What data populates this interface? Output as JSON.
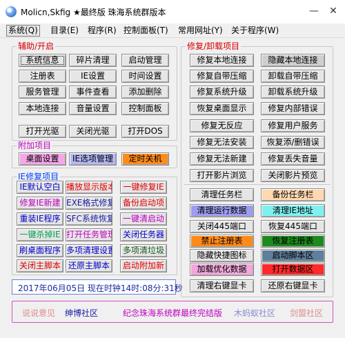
{
  "window": {
    "title": "Molicn,Skfig ★最终版 珠海系统群版本",
    "minimize_glyph": "—",
    "close_glyph": "✕"
  },
  "menu": [
    {
      "label": "系统(Q)",
      "active": true
    },
    {
      "label": "目录(E)"
    },
    {
      "label": "程序(R)"
    },
    {
      "label": "控制面板(T)"
    },
    {
      "label": "常用网址(Y)"
    },
    {
      "label": "关于程序(W)"
    }
  ],
  "groups": {
    "aux": {
      "title": "辅助/开启",
      "title_color": "#d40000"
    },
    "repair": {
      "title": "修复/卸载项目",
      "title_color": "#d40000"
    },
    "extra": {
      "title": "附加项目",
      "title_color": "#c000c0"
    },
    "ie": {
      "title": "IE修复项目",
      "title_color": "#0040ff"
    }
  },
  "buttons": {
    "aux": [
      {
        "label": "系统信息",
        "color": "#000000",
        "bg": "#e6e6e6",
        "focused": true
      },
      {
        "label": "碎片清理",
        "color": "#000000",
        "bg": "#e6e6e6"
      },
      {
        "label": "启动管理",
        "color": "#000000",
        "bg": "#e6e6e6"
      },
      {
        "label": "注册表",
        "color": "#000000",
        "bg": "#e6e6e6"
      },
      {
        "label": "IE设置",
        "color": "#000000",
        "bg": "#e6e6e6"
      },
      {
        "label": "时间设置",
        "color": "#000000",
        "bg": "#e6e6e6"
      },
      {
        "label": "服务管理",
        "color": "#000000",
        "bg": "#e6e6e6"
      },
      {
        "label": "事件查看",
        "color": "#000000",
        "bg": "#e6e6e6"
      },
      {
        "label": "添加删除",
        "color": "#000000",
        "bg": "#e6e6e6"
      },
      {
        "label": "本地连接",
        "color": "#000000",
        "bg": "#e6e6e6"
      },
      {
        "label": "音量设置",
        "color": "#000000",
        "bg": "#e6e6e6"
      },
      {
        "label": "控制面板",
        "color": "#000000",
        "bg": "#e6e6e6"
      },
      {
        "label": "打开光驱",
        "color": "#000000",
        "bg": "#e6e6e6"
      },
      {
        "label": "关闭光驱",
        "color": "#000000",
        "bg": "#e6e6e6"
      },
      {
        "label": "打开DOS",
        "color": "#000000",
        "bg": "#e6e6e6"
      }
    ],
    "extra": [
      {
        "label": "桌面设置",
        "color": "#000000",
        "bg": "#f4a6e8"
      },
      {
        "label": "IE选项管理",
        "color": "#000000",
        "bg": "#b4b8f4"
      },
      {
        "label": "定时关机",
        "color": "#000000",
        "bg": "#ff8c1a"
      }
    ],
    "ie": [
      {
        "label": "IE默认空白",
        "color": "#0000c8",
        "bg": "#e6e6e6"
      },
      {
        "label": "播放显示版本",
        "color": "#e00000",
        "bg": "#e6e6e6"
      },
      {
        "label": "一键修复IE",
        "color": "#e00000",
        "bg": "#e6e6e6"
      },
      {
        "label": "修复IE新建",
        "color": "#c000c0",
        "bg": "#e6e6e6"
      },
      {
        "label": "EXE格式修复",
        "color": "#1a1aa0",
        "bg": "#e6e6e6"
      },
      {
        "label": "备份启动项",
        "color": "#e00000",
        "bg": "#e6e6e6"
      },
      {
        "label": "重装IE程序",
        "color": "#0000c8",
        "bg": "#e6e6e6"
      },
      {
        "label": "SFC系统恢复",
        "color": "#1a1aa0",
        "bg": "#e6e6e6"
      },
      {
        "label": "一键清启动",
        "color": "#c000c0",
        "bg": "#e6e6e6"
      },
      {
        "label": "一键杀掉IE",
        "color": "#00a050",
        "bg": "#e6e6e6"
      },
      {
        "label": "打开任务管理",
        "color": "#c000c0",
        "bg": "#e6e6e6"
      },
      {
        "label": "关闭任务器",
        "color": "#0000c8",
        "bg": "#e6e6e6"
      },
      {
        "label": "刷桌面程序",
        "color": "#0000c8",
        "bg": "#e6e6e6"
      },
      {
        "label": "多项清理设置",
        "color": "#0000c8",
        "bg": "#e6e6e6"
      },
      {
        "label": "多项清垃圾",
        "color": "#1a5a1a",
        "bg": "#e6e6e6"
      },
      {
        "label": "关闭主脚本",
        "color": "#e00000",
        "bg": "#e6e6e6"
      },
      {
        "label": "还原主脚本",
        "color": "#0000c8",
        "bg": "#e6e6e6"
      },
      {
        "label": "启动附加新",
        "color": "#e00000",
        "bg": "#e6e6e6"
      }
    ],
    "repair": [
      {
        "label": "修复本地连接",
        "color": "#000000",
        "bg": "#e6e6e6"
      },
      {
        "label": "隐藏本地连接",
        "color": "#000000",
        "bg": "#cfcfcf"
      },
      {
        "label": "修复自带压缩",
        "color": "#000000",
        "bg": "#e6e6e6"
      },
      {
        "label": "卸载自带压缩",
        "color": "#000000",
        "bg": "#e6e6e6"
      },
      {
        "label": "修复系统升级",
        "color": "#000000",
        "bg": "#e6e6e6"
      },
      {
        "label": "卸载系统升级",
        "color": "#000000",
        "bg": "#e6e6e6"
      },
      {
        "label": "恢复桌面显示",
        "color": "#000000",
        "bg": "#e6e6e6"
      },
      {
        "label": "修复内部错误",
        "color": "#000000",
        "bg": "#e6e6e6"
      },
      {
        "label": "修复无反应",
        "color": "#000000",
        "bg": "#e6e6e6"
      },
      {
        "label": "修复用户服务",
        "color": "#000000",
        "bg": "#e6e6e6"
      },
      {
        "label": "修复无法安装",
        "color": "#000000",
        "bg": "#e6e6e6"
      },
      {
        "label": "恢复添/删错误",
        "color": "#000000",
        "bg": "#e6e6e6"
      },
      {
        "label": "修复无法新建",
        "color": "#000000",
        "bg": "#e6e6e6"
      },
      {
        "label": "修复丢失音量",
        "color": "#000000",
        "bg": "#e6e6e6"
      },
      {
        "label": "打开影片浏览",
        "color": "#000000",
        "bg": "#e6e6e6"
      },
      {
        "label": "关闭影片预览",
        "color": "#000000",
        "bg": "#e6e6e6"
      }
    ],
    "tools": [
      {
        "label": "清理任务栏",
        "color": "#000000",
        "bg": "#e6e6e6"
      },
      {
        "label": "备份任务栏",
        "color": "#000000",
        "bg": "#ffd8b0"
      },
      {
        "label": "清理运行数据",
        "color": "#000000",
        "bg": "#9c9cf0"
      },
      {
        "label": "清理IE地址",
        "color": "#000000",
        "bg": "#7ff0f0"
      },
      {
        "label": "关闭445端口",
        "color": "#000000",
        "bg": "#e6e6e6"
      },
      {
        "label": "恢复445端口",
        "color": "#000000",
        "bg": "#e6e6e6"
      },
      {
        "label": "禁止注册表",
        "color": "#000000",
        "bg": "#ff8a1a"
      },
      {
        "label": "恢复注册表",
        "color": "#000000",
        "bg": "#1e8a1e"
      },
      {
        "label": "隐藏快捷图标",
        "color": "#000000",
        "bg": "#e6e6e6"
      },
      {
        "label": "启动脚本区",
        "color": "#000000",
        "bg": "#5f7f9a"
      },
      {
        "label": "加载优化数据",
        "color": "#000000",
        "bg": "#f3a7dc"
      },
      {
        "label": "打开数据区",
        "color": "#000000",
        "bg": "#ff2a2a"
      },
      {
        "label": "清理右键显卡",
        "color": "#000000",
        "bg": "#e6e6e6"
      },
      {
        "label": "还原右键显卡",
        "color": "#000000",
        "bg": "#e6e6e6"
      }
    ]
  },
  "status": {
    "text": "2017年06月05日 现在时钟14时:08分:31秒"
  },
  "links": [
    {
      "label": "说说意见",
      "color": "#e08a8a"
    },
    {
      "label": "绅博社区",
      "color": "#1a1aa0"
    },
    {
      "label": "纪念珠海系统群最终完结版",
      "color": "#c000c0"
    },
    {
      "label": "木蚂蚁社区",
      "color": "#8a8ad8"
    },
    {
      "label": "剑盟社区",
      "color": "#e08a8a"
    }
  ]
}
